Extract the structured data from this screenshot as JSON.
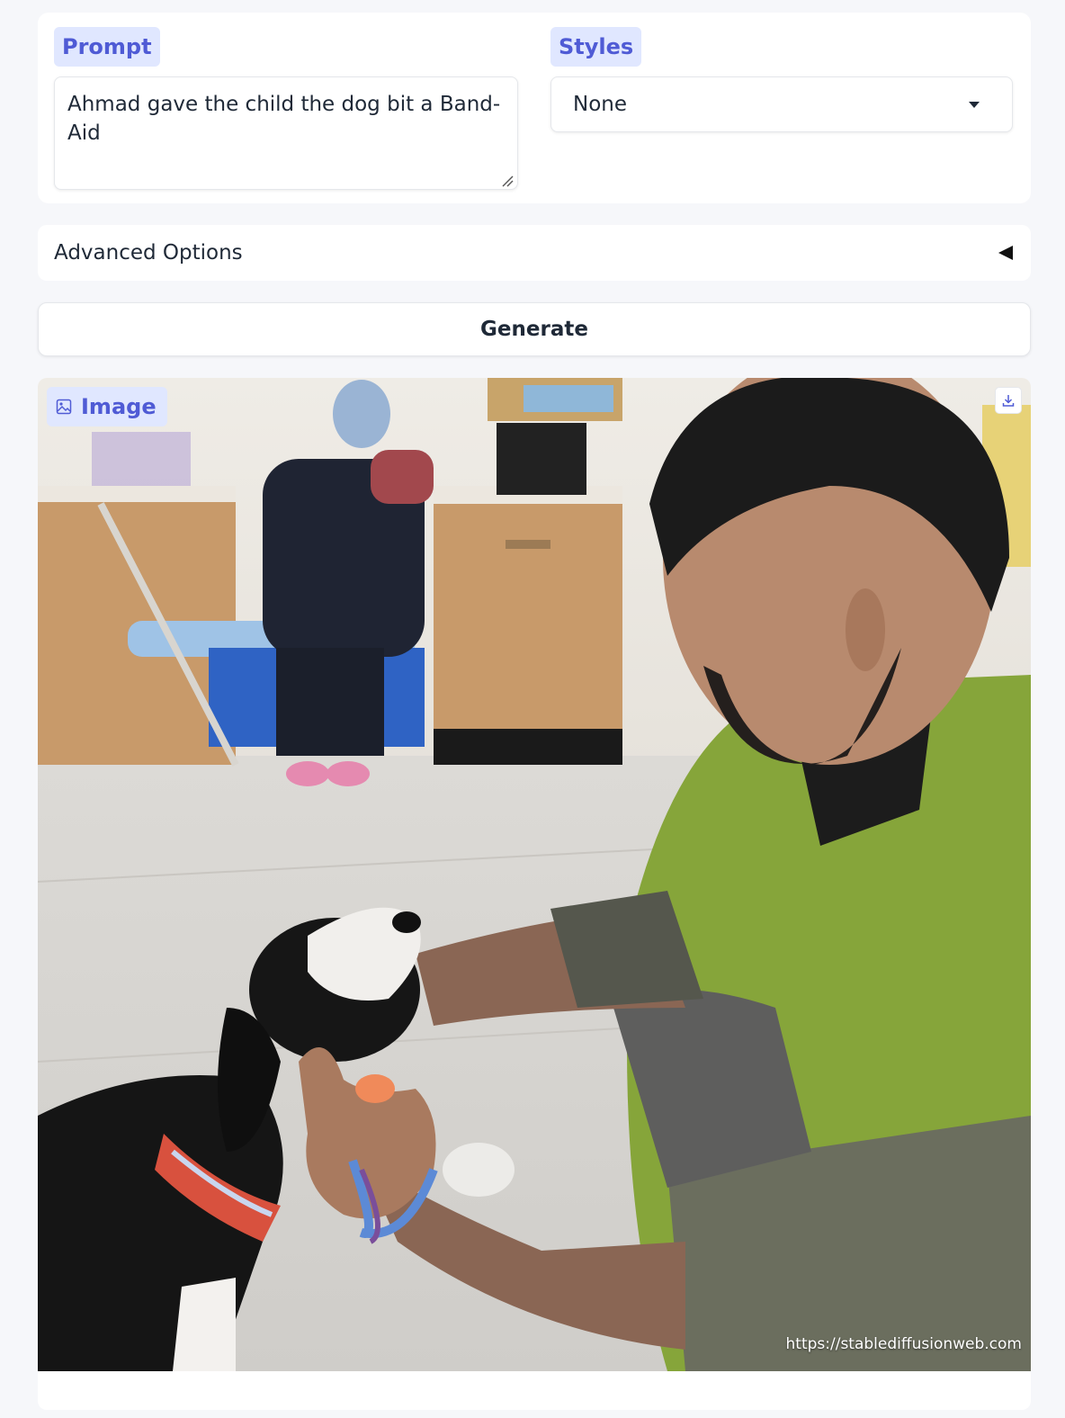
{
  "prompt": {
    "label": "Prompt",
    "value": "Ahmad gave the child the dog bit a Band-Aid"
  },
  "styles": {
    "label": "Styles",
    "selected": "None"
  },
  "advanced": {
    "label": "Advanced Options",
    "collapsed": true
  },
  "generate": {
    "label": "Generate"
  },
  "output": {
    "label": "Image",
    "watermark": "https://stablediffusionweb.com",
    "icons": [
      "image-icon",
      "download-icon"
    ]
  },
  "colors": {
    "accent": "#4f5bd5",
    "chip_bg": "#e0e7ff",
    "page_bg": "#f6f7fa"
  }
}
